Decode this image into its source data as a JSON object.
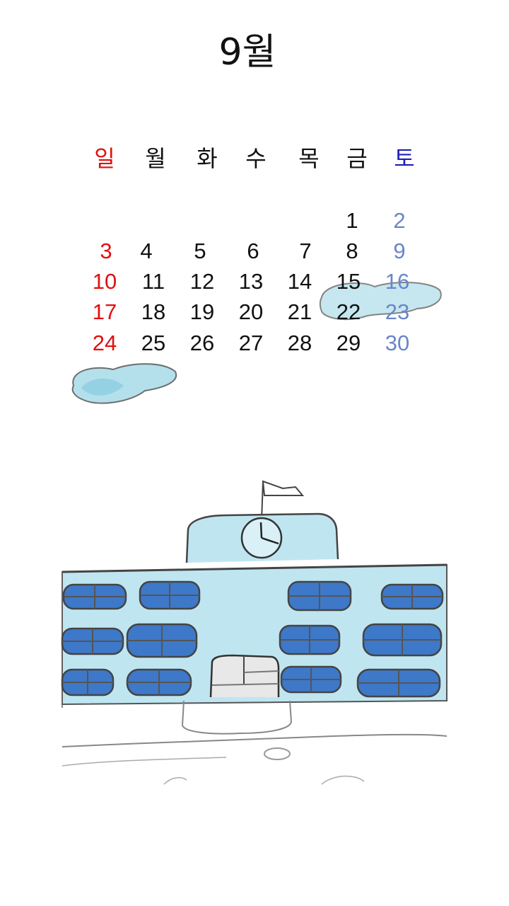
{
  "calendar": {
    "month_title": "9월",
    "colors": {
      "sunday": "#e01010",
      "weekday": "#111111",
      "saturday_header": "#1f1fb8",
      "saturday_day": "#6a86c8"
    },
    "weekdays": [
      "일",
      "월",
      "화",
      "수",
      "목",
      "금",
      "토"
    ],
    "weeks": [
      [
        "",
        "",
        "",
        "",
        "",
        "1",
        "2"
      ],
      [
        "3",
        "4",
        "5",
        "6",
        "7",
        "8",
        "9"
      ],
      [
        "10",
        "11",
        "12",
        "13",
        "14",
        "15",
        "16"
      ],
      [
        "17",
        "18",
        "19",
        "20",
        "21",
        "22",
        "23"
      ],
      [
        "24",
        "25",
        "26",
        "27",
        "28",
        "29",
        "30"
      ]
    ]
  },
  "illustration": {
    "icons": [
      "cloud-icon",
      "school-building-icon",
      "clock-icon",
      "flag-icon",
      "window-icon"
    ]
  }
}
